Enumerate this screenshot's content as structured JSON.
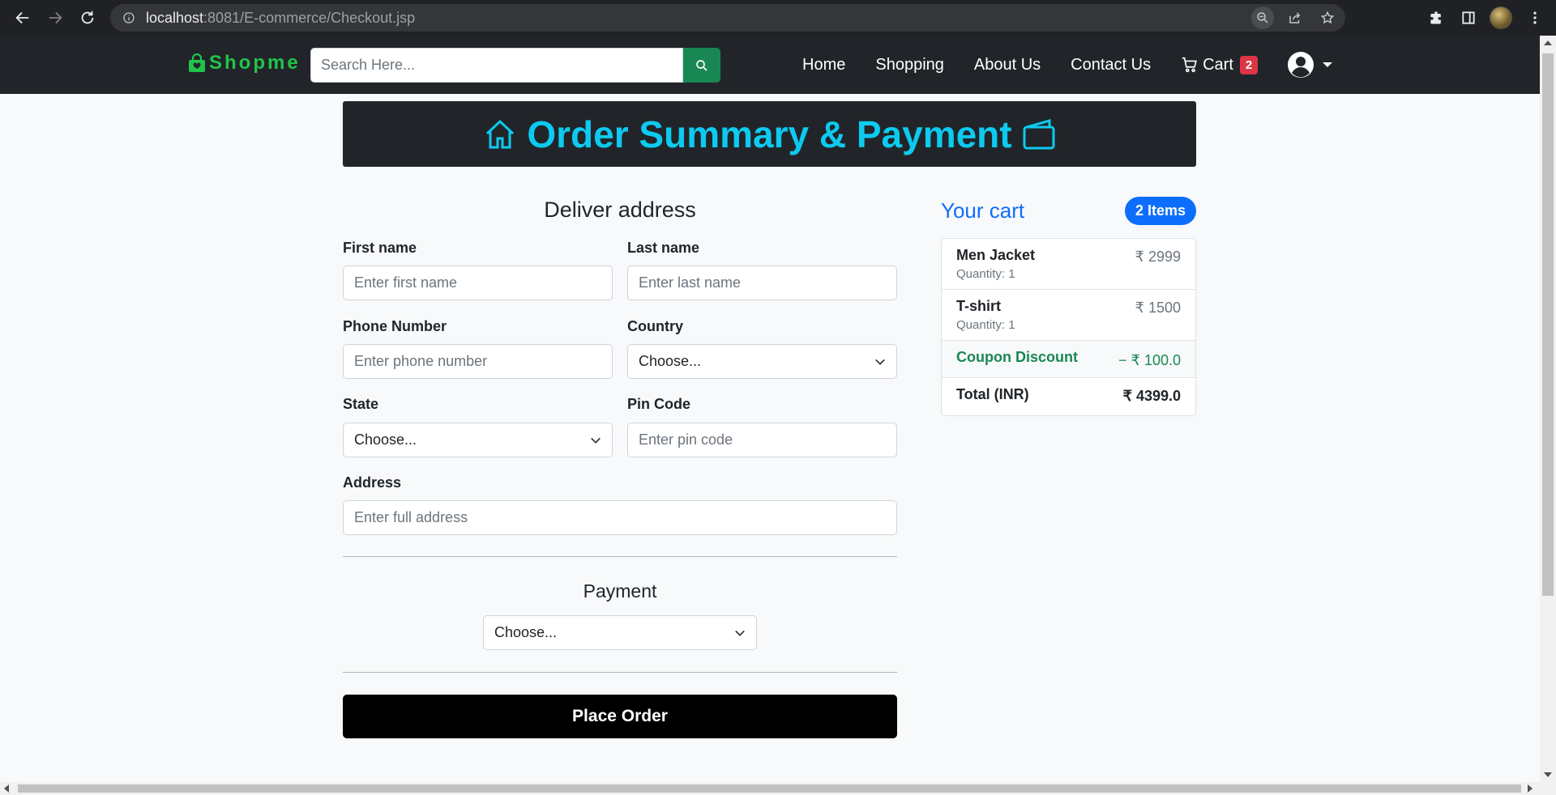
{
  "browser": {
    "url_host": "localhost",
    "url_rest": ":8081/E-commerce/Checkout.jsp"
  },
  "navbar": {
    "brand": "Shopme",
    "search_placeholder": "Search Here...",
    "links": [
      "Home",
      "Shopping",
      "About Us",
      "Contact Us"
    ],
    "cart_label": "Cart",
    "cart_count": "2"
  },
  "banner": {
    "title": "Order Summary & Payment"
  },
  "address_form": {
    "heading": "Deliver address",
    "first_name_label": "First name",
    "first_name_placeholder": "Enter first name",
    "last_name_label": "Last name",
    "last_name_placeholder": "Enter last name",
    "phone_label": "Phone Number",
    "phone_placeholder": "Enter phone number",
    "country_label": "Country",
    "country_value": "Choose...",
    "state_label": "State",
    "state_value": "Choose...",
    "pin_label": "Pin Code",
    "pin_placeholder": "Enter pin code",
    "address_label": "Address",
    "address_placeholder": "Enter full address"
  },
  "payment": {
    "heading": "Payment",
    "method_value": "Choose...",
    "submit_label": "Place Order"
  },
  "cart": {
    "title": "Your cart",
    "items_badge": "2 Items",
    "items": [
      {
        "name": "Men Jacket",
        "quantity": "Quantity: 1",
        "price": "₹ 2999"
      },
      {
        "name": "T-shirt",
        "quantity": "Quantity: 1",
        "price": "₹ 1500"
      }
    ],
    "coupon_label": "Coupon Discount",
    "coupon_value": "− ₹ 100.0",
    "total_label": "Total (INR)",
    "total_value": "₹ 4399.0"
  },
  "colors": {
    "brand": "#20c44a",
    "banner_text": "#0dcaf0",
    "accent_blue": "#0d6efd",
    "coupon_green": "#198754",
    "badge_red": "#dc3545"
  }
}
